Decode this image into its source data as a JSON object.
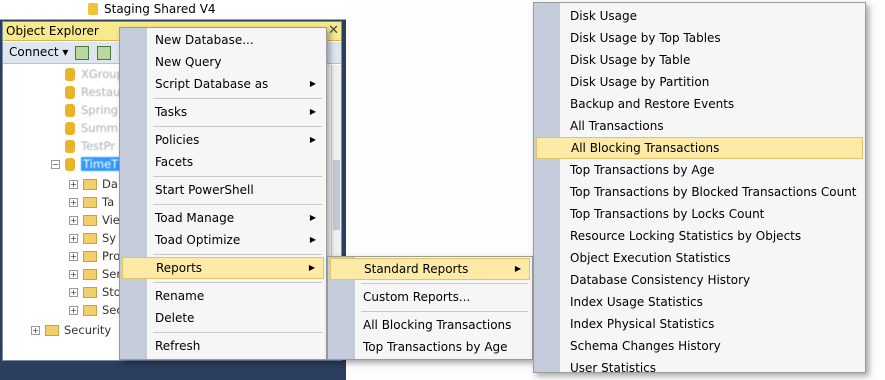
{
  "top_item": {
    "label": "Staging Shared V4"
  },
  "object_explorer": {
    "title": "Object Explorer",
    "close_glyph": "✕",
    "connect_label": "Connect ▾",
    "tree": [
      {
        "label": "XGroup",
        "indent": 1
      },
      {
        "label": "Restau",
        "indent": 1
      },
      {
        "label": "Spring",
        "indent": 1
      },
      {
        "label": "Summ",
        "indent": 1
      },
      {
        "label": "TestPr",
        "indent": 1
      },
      {
        "label": "TimeT",
        "indent": 1,
        "selected": true
      },
      {
        "label": "Da",
        "indent": 2
      },
      {
        "label": "Ta",
        "indent": 2
      },
      {
        "label": "Vie",
        "indent": 2
      },
      {
        "label": "Sy",
        "indent": 2
      },
      {
        "label": "Pro",
        "indent": 2
      },
      {
        "label": "Ser",
        "indent": 2
      },
      {
        "label": "Sto",
        "indent": 2
      },
      {
        "label": "Sec",
        "indent": 2
      },
      {
        "label": "Security",
        "indent": 0
      }
    ]
  },
  "context_menu": {
    "items": [
      {
        "label": "New Database...",
        "group": 0
      },
      {
        "label": "New Query",
        "group": 0
      },
      {
        "label": "Script Database as",
        "group": 0,
        "submenu": true
      },
      {
        "label": "Tasks",
        "group": 1,
        "submenu": true
      },
      {
        "label": "Policies",
        "group": 2,
        "submenu": true
      },
      {
        "label": "Facets",
        "group": 2
      },
      {
        "label": "Start PowerShell",
        "group": 3
      },
      {
        "label": "Toad Manage",
        "group": 4,
        "submenu": true
      },
      {
        "label": "Toad Optimize",
        "group": 4,
        "submenu": true
      },
      {
        "label": "Reports",
        "group": 5,
        "submenu": true,
        "highlighted": true
      },
      {
        "label": "Rename",
        "group": 6
      },
      {
        "label": "Delete",
        "group": 6
      },
      {
        "label": "Refresh",
        "group": 7
      }
    ]
  },
  "reports_menu": {
    "items": [
      {
        "label": "Standard Reports",
        "submenu": true,
        "highlighted": true
      },
      {
        "label": "Custom Reports..."
      },
      {
        "label": "All Blocking Transactions"
      },
      {
        "label": "Top Transactions by Age"
      }
    ]
  },
  "standard_reports_menu": {
    "items": [
      {
        "label": "Disk Usage"
      },
      {
        "label": "Disk Usage by Top Tables"
      },
      {
        "label": "Disk Usage by Table"
      },
      {
        "label": "Disk Usage by Partition"
      },
      {
        "label": "Backup and Restore Events"
      },
      {
        "label": "All Transactions"
      },
      {
        "label": "All Blocking Transactions",
        "highlighted": true
      },
      {
        "label": "Top Transactions by Age"
      },
      {
        "label": "Top Transactions by Blocked Transactions Count"
      },
      {
        "label": "Top Transactions by Locks Count"
      },
      {
        "label": "Resource Locking Statistics by Objects"
      },
      {
        "label": "Object Execution Statistics"
      },
      {
        "label": "Database Consistency History"
      },
      {
        "label": "Index Usage Statistics"
      },
      {
        "label": "Index Physical Statistics"
      },
      {
        "label": "Schema Changes History"
      },
      {
        "label": "User Statistics"
      }
    ]
  },
  "submenu_arrow": "▶"
}
